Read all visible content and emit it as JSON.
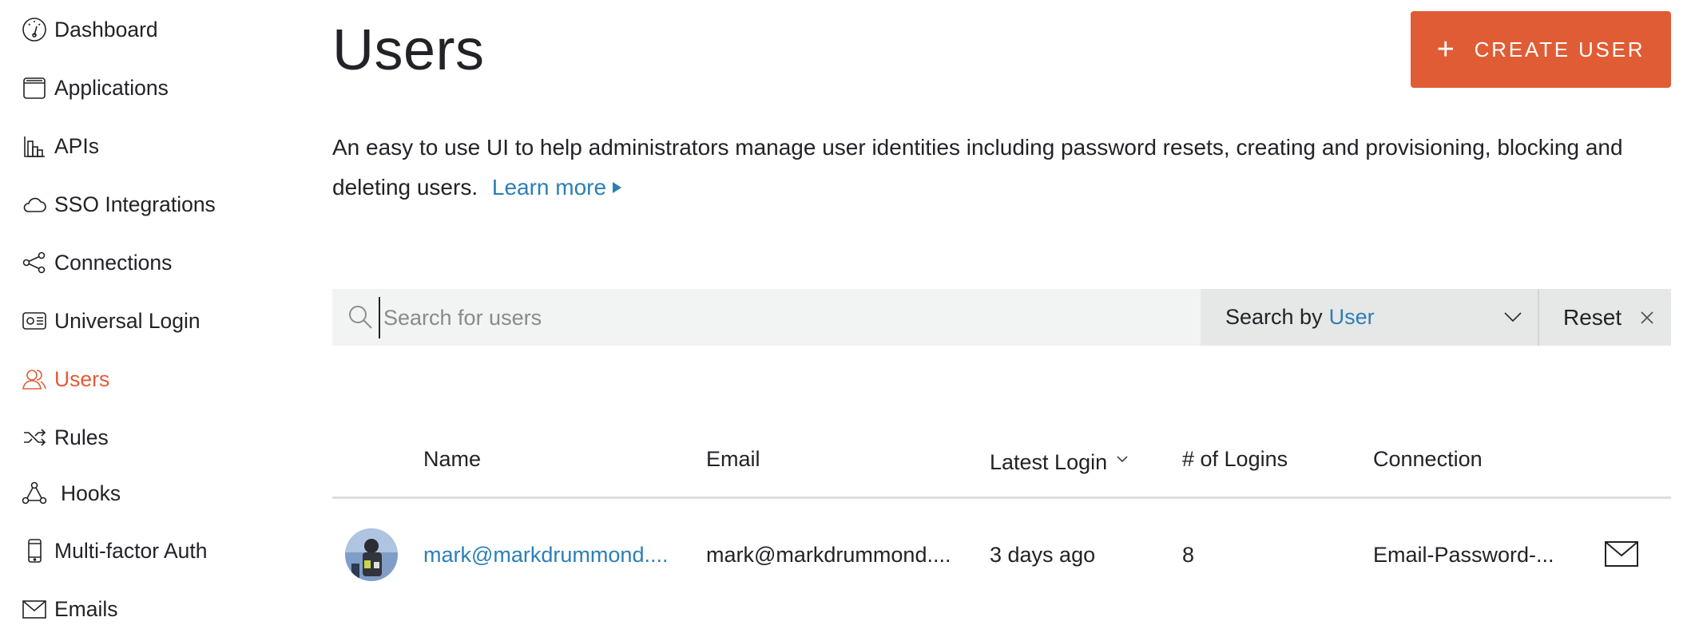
{
  "sidebar": {
    "items": [
      {
        "label": "Dashboard",
        "icon": "dashboard-gauge-icon"
      },
      {
        "label": "Applications",
        "icon": "applications-window-icon"
      },
      {
        "label": "APIs",
        "icon": "apis-bars-icon"
      },
      {
        "label": "SSO Integrations",
        "icon": "cloud-icon"
      },
      {
        "label": "Connections",
        "icon": "connections-share-icon"
      },
      {
        "label": "Universal Login",
        "icon": "universal-login-card-icon"
      },
      {
        "label": "Users",
        "icon": "users-icon",
        "active": true
      },
      {
        "label": "Rules",
        "icon": "rules-shuffle-icon"
      },
      {
        "label": "Hooks",
        "icon": "hooks-nodes-icon"
      },
      {
        "label": "Multi-factor Auth",
        "icon": "mobile-phone-icon"
      },
      {
        "label": "Emails",
        "icon": "envelope-icon"
      }
    ],
    "active_color": "#e05d35"
  },
  "header": {
    "title": "Users",
    "create_button_label": "CREATE USER",
    "create_button_color": "#e05c35"
  },
  "description": {
    "text": "An easy to use UI to help administrators manage user identities including password resets, creating and provisioning, blocking and deleting users.",
    "learn_more": "Learn more"
  },
  "search": {
    "placeholder": "Search for users",
    "value": "",
    "search_by_label": "Search by",
    "search_by_value": "User",
    "reset_label": "Reset"
  },
  "table": {
    "columns": [
      "Name",
      "Email",
      "Latest Login",
      "# of Logins",
      "Connection"
    ],
    "sorted_column": "Latest Login",
    "rows": [
      {
        "name": "mark@markdrummond....",
        "email": "mark@markdrummond....",
        "latest_login": "3 days ago",
        "logins": "8",
        "connection": "Email-Password-..."
      }
    ]
  },
  "colors": {
    "link": "#2b7fb6",
    "accent": "#e05c35",
    "search_bg": "#f2f3f3"
  }
}
